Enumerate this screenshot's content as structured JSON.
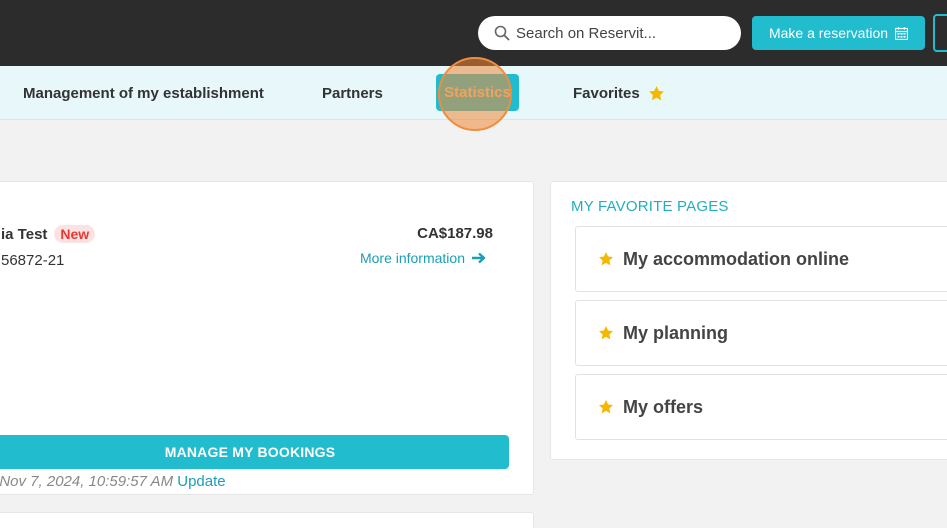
{
  "header": {
    "search_placeholder": "Search on Reservit...",
    "reserve_label": "Make a reservation"
  },
  "nav": {
    "items": [
      {
        "label": "Management of my establishment"
      },
      {
        "label": "Partners"
      },
      {
        "label": "Statistics",
        "active": true
      },
      {
        "label": "Favorites",
        "icon": "star-icon"
      }
    ]
  },
  "booking": {
    "guest_name": "ia Test",
    "badge": "New",
    "reference": "56872-21",
    "price": "CA$187.98",
    "more_info": "More information",
    "manage_label": "MANAGE MY BOOKINGS",
    "last_update_text": ": Nov 7, 2024, 10:59:57 AM",
    "update_link": "Update"
  },
  "favorites": {
    "title": "MY FAVORITE PAGES",
    "items": [
      {
        "label": "My accommodation online"
      },
      {
        "label": "My planning"
      },
      {
        "label": "My offers"
      }
    ]
  },
  "colors": {
    "accent": "#22bccf",
    "topbar": "#2c2c2c",
    "nav_bg": "#e7f7fa",
    "star": "#f5b800",
    "new_badge": "#e53935",
    "click_marker": "#f08d3c"
  }
}
